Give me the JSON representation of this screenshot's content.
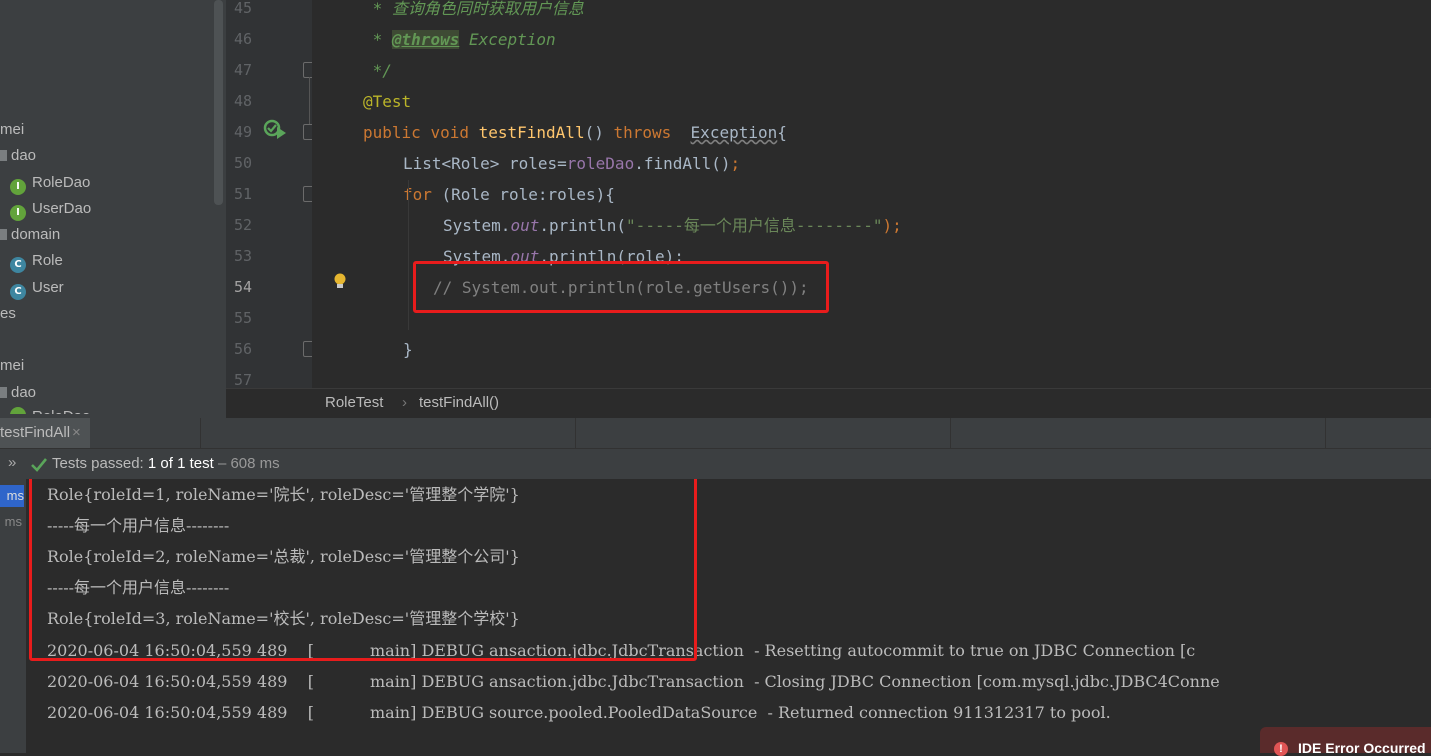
{
  "project_tree": {
    "items": [
      {
        "kind": "text",
        "label": "mei"
      },
      {
        "kind": "folder",
        "label": "dao"
      },
      {
        "kind": "interface",
        "icon": "I",
        "label": "RoleDao"
      },
      {
        "kind": "interface",
        "icon": "I",
        "label": "UserDao"
      },
      {
        "kind": "folder",
        "label": "domain"
      },
      {
        "kind": "class",
        "icon": "C",
        "label": "Role"
      },
      {
        "kind": "class",
        "icon": "C",
        "label": "User"
      },
      {
        "kind": "text",
        "label": "es"
      },
      {
        "kind": "text",
        "label": "mei"
      },
      {
        "kind": "folder",
        "label": "dao"
      },
      {
        "kind": "text",
        "label": "RoleDao..."
      }
    ]
  },
  "editor": {
    "line_numbers": [
      "45",
      "46",
      "47",
      "48",
      "49",
      "50",
      "51",
      "52",
      "53",
      "54",
      "55",
      "56",
      "57"
    ],
    "comment_45": " * 查询角色同时获取用户信息",
    "comment_46_star": " * ",
    "comment_46_tag": "@throws",
    "comment_46_rest": " Exception",
    "comment_47": " */",
    "line_48": "@Test",
    "l49_public": "public",
    "l49_void": "void",
    "l49_method": "testFindAll",
    "l49_paren": "()",
    "l49_throws": "throws",
    "l49_exception": "Exception",
    "l49_brace": "{",
    "l50_a": "List<Role> roles=",
    "l50_field": "roleDao",
    "l50_b": ".findAll()",
    "l50_semi": ";",
    "l51_for": "for",
    "l51_rest": " (Role role:roles){",
    "l52_a": "System.",
    "l52_out": "out",
    "l52_b": ".println(",
    "l52_str": "\"-----每一个用户信息--------\"",
    "l52_c": ");",
    "l53_a": "System.",
    "l53_out": "out",
    "l53_b": ".println(role);",
    "l54": "// System.out.println(role.getUsers());",
    "l56": "}"
  },
  "breadcrumb": {
    "class": "RoleTest",
    "sep": "›",
    "method": "testFindAll()"
  },
  "run_panel": {
    "tab_label": "testFindAll",
    "tab_close": "×",
    "expand": "»",
    "status_prefix": "Tests passed:",
    "status_count": "1 of 1 test",
    "status_time": "– 608 ms",
    "left_times": [
      "ms",
      "ms"
    ]
  },
  "console_lines": [
    "Role{roleId=1, roleName='院长', roleDesc='管理整个学院'}",
    "-----每一个用户信息--------",
    "Role{roleId=2, roleName='总裁', roleDesc='管理整个公司'}",
    "-----每一个用户信息--------",
    "Role{roleId=3, roleName='校长', roleDesc='管理整个学校'}",
    "2020-06-04 16:50:04,559 489    [           main] DEBUG ansaction.jdbc.JdbcTransaction  - Resetting autocommit to true on JDBC Connection [c",
    "2020-06-04 16:50:04,559 489    [           main] DEBUG ansaction.jdbc.JdbcTransaction  - Closing JDBC Connection [com.mysql.jdbc.JDBC4Conne",
    "2020-06-04 16:50:04,559 489    [           main] DEBUG source.pooled.PooledDataSource  - Returned connection 911312317 to pool."
  ],
  "notification": {
    "label": "IDE Error Occurred"
  },
  "colors": {
    "highlight_box": "#e81c1c",
    "pass_green": "#5aa55a"
  }
}
